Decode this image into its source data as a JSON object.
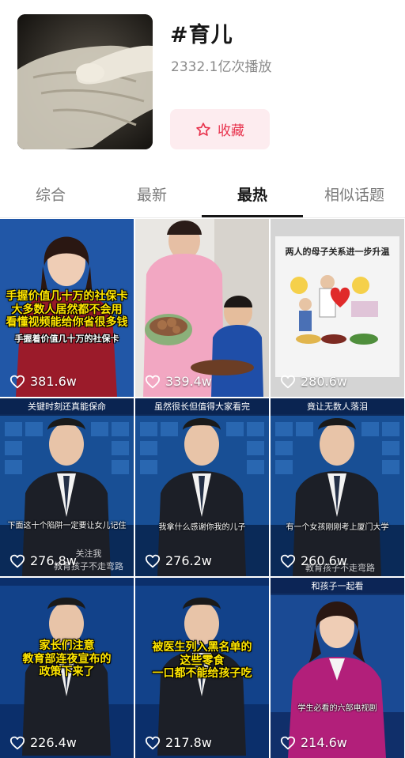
{
  "header": {
    "topic_title": "#育儿",
    "play_count": "2332.1亿次播放",
    "favorite_label": "收藏",
    "accent_color": "#e8344e"
  },
  "tabs": [
    {
      "label": "综合",
      "active": false
    },
    {
      "label": "最新",
      "active": false
    },
    {
      "label": "最热",
      "active": true
    },
    {
      "label": "相似话题",
      "active": false
    }
  ],
  "videos": [
    {
      "likes": "381.6w",
      "caption": "手握价值几十万的社保卡\n大多数人居然都不会用\n看懂视频能给你省很多钱",
      "subcaption": "手握着价值几十万的社保卡"
    },
    {
      "likes": "339.4w"
    },
    {
      "likes": "280.6w",
      "caption": "两人的母子关系进一步升温"
    },
    {
      "likes": "276.8w",
      "top_banner": "关键时刻还真能保命",
      "subcaption": "下面这十个陷阱一定要让女儿记住",
      "ghost": "关注我\n教育孩子不走弯路"
    },
    {
      "likes": "276.2w",
      "top_banner": "虽然很长但值得大家看完",
      "subcaption": "我拿什么感谢你我的儿子"
    },
    {
      "likes": "260.6w",
      "top_banner": "竟让无数人落泪",
      "subcaption": "有一个女孩刚刚考上厦门大学",
      "ghost": "教育孩子不走弯路"
    },
    {
      "likes": "226.4w",
      "caption": "家长们注意\n教育部连夜宣布的\n政策下来了"
    },
    {
      "likes": "217.8w",
      "caption": "被医生列入黑名单的\n这些零食\n一口都不能给孩子吃"
    },
    {
      "likes": "214.6w",
      "top_banner": "和孩子一起看",
      "subcaption": "学生必看的六部电视剧"
    }
  ]
}
